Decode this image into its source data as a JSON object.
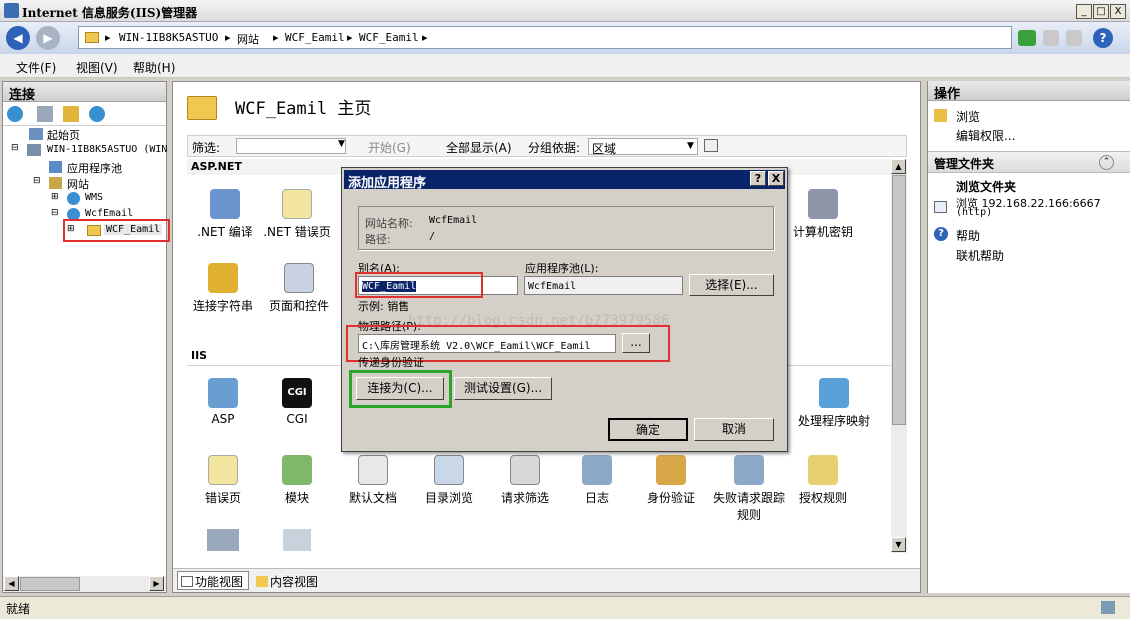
{
  "window": {
    "title": "Internet 信息服务(IIS)管理器",
    "buttons": [
      "_",
      "□",
      "X"
    ]
  },
  "address": {
    "segments": [
      "WIN-1IB8K5ASTUO",
      "网站",
      "WCF_Eamil"
    ]
  },
  "menu": [
    "文件(F)",
    "视图(V)",
    "帮助(H)"
  ],
  "left_pane": {
    "header": "连接",
    "tree": [
      {
        "label": "起始页"
      },
      {
        "label": "WIN-1IB8K5ASTUO (WIN"
      },
      {
        "label": "应用程序池"
      },
      {
        "label": "网站"
      },
      {
        "label": "WMS"
      },
      {
        "label": "WcfEmail"
      },
      {
        "label": "WCF_Eamil"
      }
    ]
  },
  "center": {
    "title": "WCF_Eamil 主页",
    "filter_label": "筛选:",
    "start_label": "开始(G)",
    "show_all_label": "全部显示(A)",
    "group_label": "分组依据:",
    "group_value": "区域",
    "sections": [
      "ASP.NET",
      "IIS"
    ],
    "aspnet_tiles": [
      ".NET 编译",
      ".NET 错误页",
      "连接字符串",
      "页面和控件",
      "计算机密钥"
    ],
    "iis_tiles": [
      "ASP",
      "CGI",
      "处理程序映射",
      "错误页",
      "模块",
      "默认文档",
      "目录浏览",
      "请求筛选",
      "日志",
      "身份验证",
      "失败请求跟踪规则",
      "授权规则"
    ],
    "bottom_tabs": [
      "功能视图",
      "内容视图"
    ]
  },
  "right_pane": {
    "header": "操作",
    "browse": "浏览",
    "edit_perms": "编辑权限...",
    "manage_header": "管理文件夹",
    "browse_folder": "浏览文件夹",
    "browse_addr": "浏览 192.168.22.166:6667",
    "http": "(http)",
    "help": "帮助",
    "online_help": "联机帮助"
  },
  "dialog": {
    "title": "添加应用程序",
    "site_name_label": "网站名称:",
    "site_name": "WcfEmail",
    "path_label": "路径:",
    "path": "/",
    "alias_label": "别名(A):",
    "alias_value": "WCF_Eamil",
    "pool_label": "应用程序池(L):",
    "pool_value": "WcfEmail",
    "select_button": "选择(E)...",
    "example": "示例: 销售",
    "physical_label": "物理路径(P):",
    "physical_value": "C:\\库房管理系统 V2.0\\WCF_Eamil\\WCF_Eamil",
    "browse_button": "...",
    "auth_label": "传递身份验证",
    "connect_button": "连接为(C)...",
    "test_button": "测试设置(G)...",
    "ok_button": "确定",
    "cancel_button": "取消",
    "help_button": "?",
    "close_button": "X"
  },
  "watermark": "http://blog.csdn.net/b273979586",
  "status": {
    "text": "就绪"
  }
}
